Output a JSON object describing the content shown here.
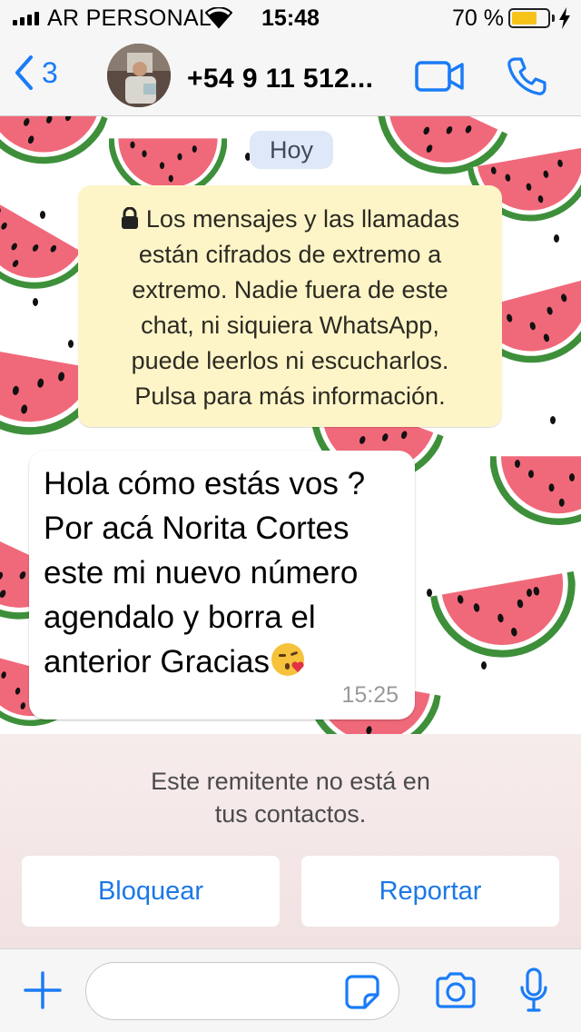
{
  "status_bar": {
    "carrier": "AR PERSONAL",
    "time": "15:48",
    "battery_percent": "70 %",
    "battery_level": 0.7
  },
  "nav": {
    "back_count": "3",
    "contact": "+54 9 11 512..."
  },
  "chat": {
    "date_label": "Hoy",
    "encryption_notice": [
      "Los mensajes y las llamadas",
      "están cifrados de extremo a",
      "extremo. Nadie fuera de este",
      "chat, ni siquiera WhatsApp,",
      "puede leerlos ni escucharlos.",
      "Pulsa para más información."
    ],
    "message": {
      "lines": [
        "Hola cómo estás vos ?",
        "Por acá Norita Cortes",
        "este mi nuevo número",
        "agendalo y borra el",
        "anterior Gracias"
      ],
      "emoji": "face-blowing-kiss",
      "time": "15:25"
    }
  },
  "unknown_sender": {
    "message_line1": "Este remitente no está en",
    "message_line2": "tus contactos.",
    "block_label": "Bloquear",
    "report_label": "Reportar"
  },
  "composer": {
    "placeholder": ""
  },
  "icons": {
    "back": "chevron-left-icon",
    "video": "video-camera-icon",
    "call": "phone-icon",
    "lock": "lock-icon",
    "plus": "plus-icon",
    "sticker": "sticker-icon",
    "camera": "camera-icon",
    "mic": "microphone-icon"
  },
  "colors": {
    "accent": "#1a7cf6",
    "notice_bg": "#fdf5c8",
    "date_chip_bg": "#dfe8f8",
    "battery": "#f7c31b",
    "watermelon_flesh": "#f0697a",
    "watermelon_rind": "#3e8f3a"
  }
}
